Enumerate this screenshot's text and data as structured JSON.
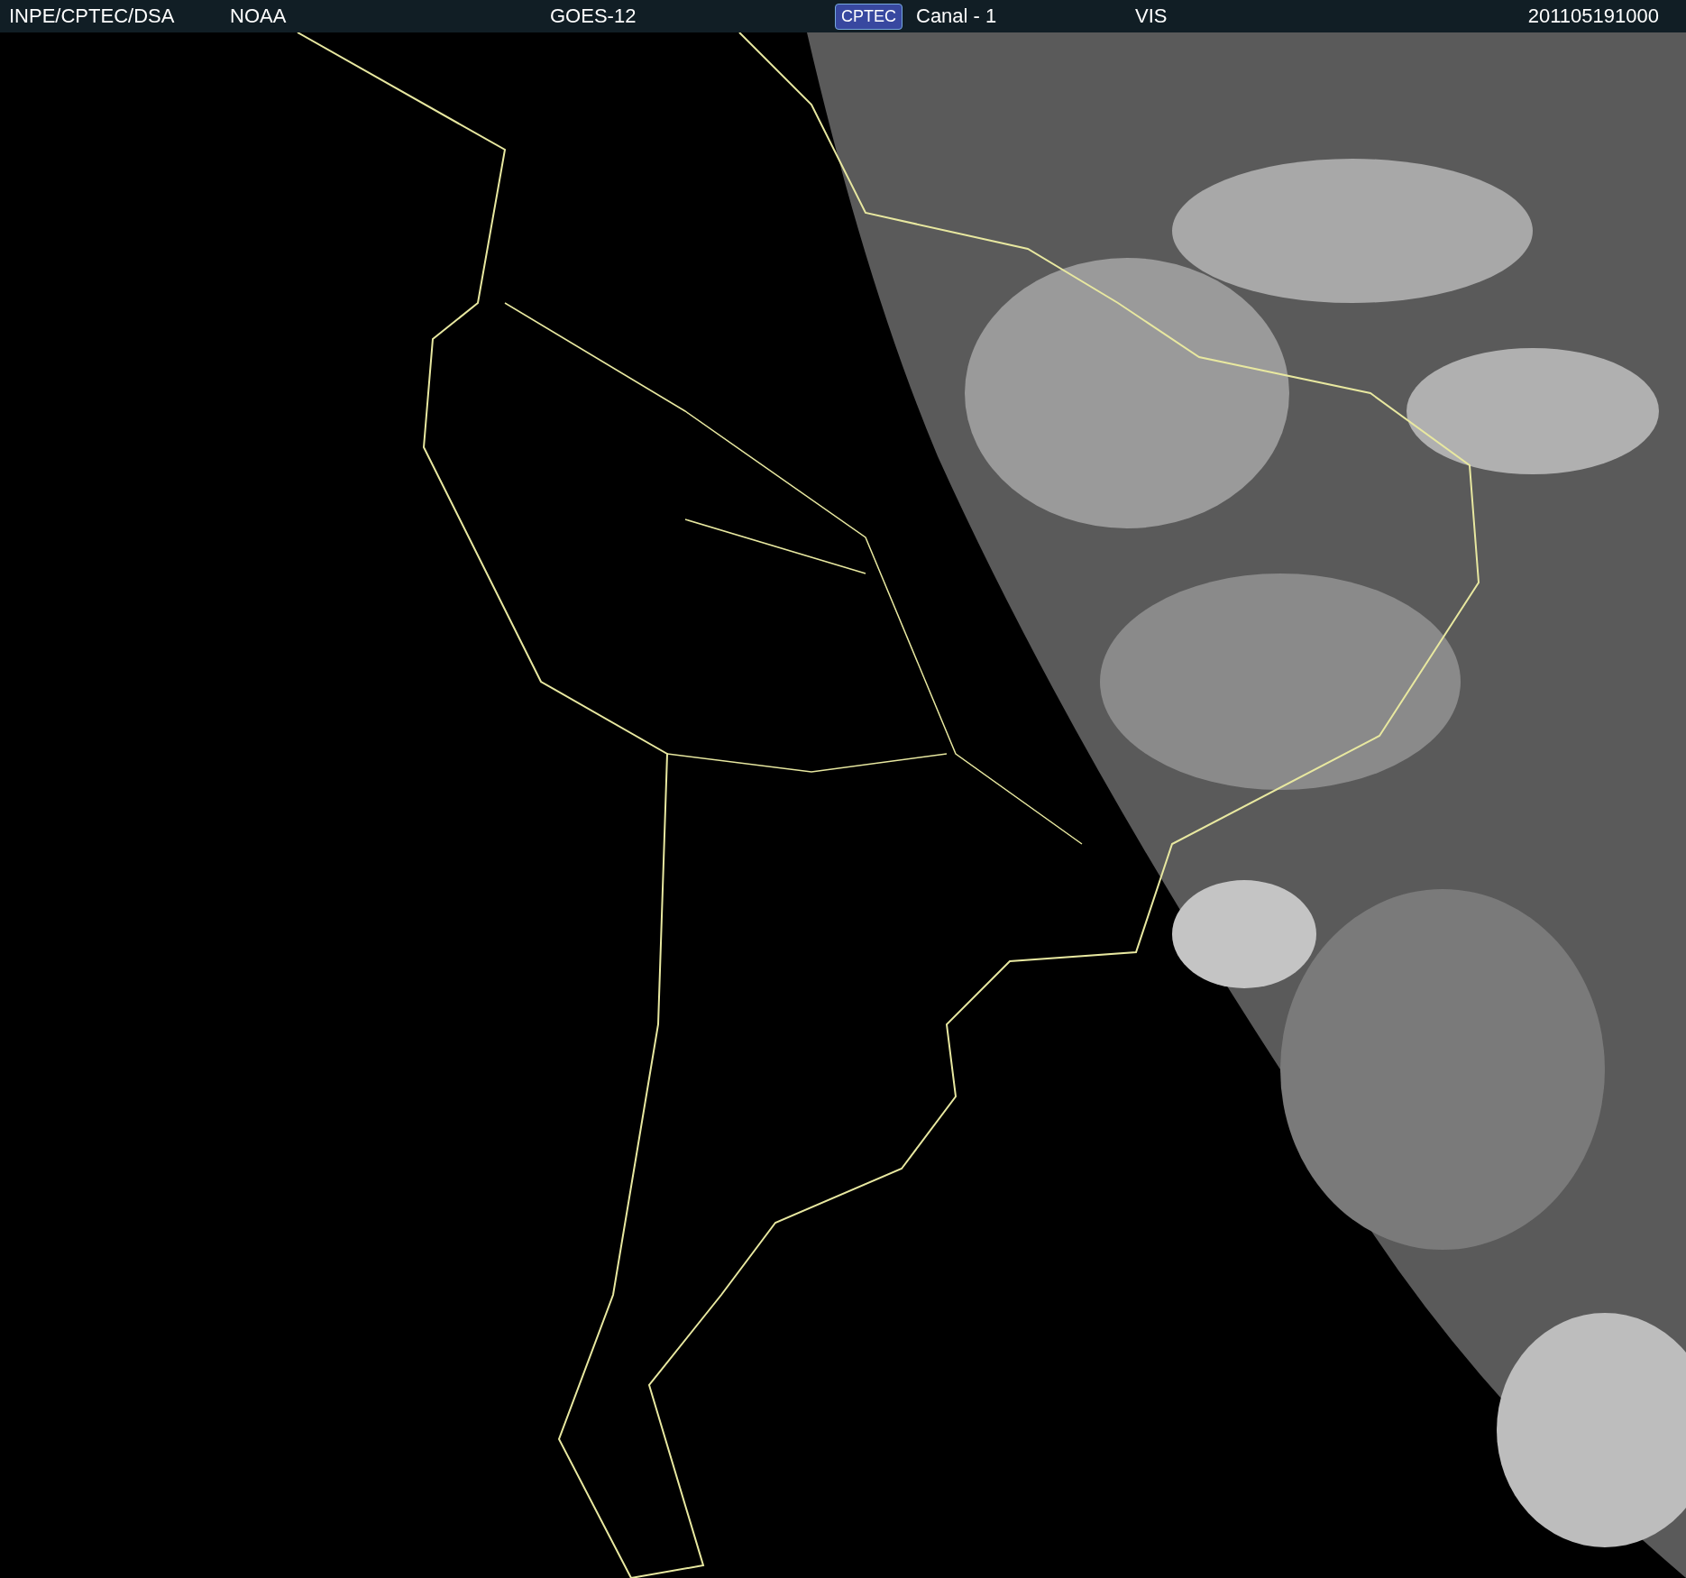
{
  "header": {
    "source": "INPE/CPTEC/DSA",
    "agency": "NOAA",
    "satellite": "GOES-12",
    "logo": "CPTEC",
    "channel": "Canal - 1",
    "band": "VIS",
    "timestamp": "201105191000"
  }
}
